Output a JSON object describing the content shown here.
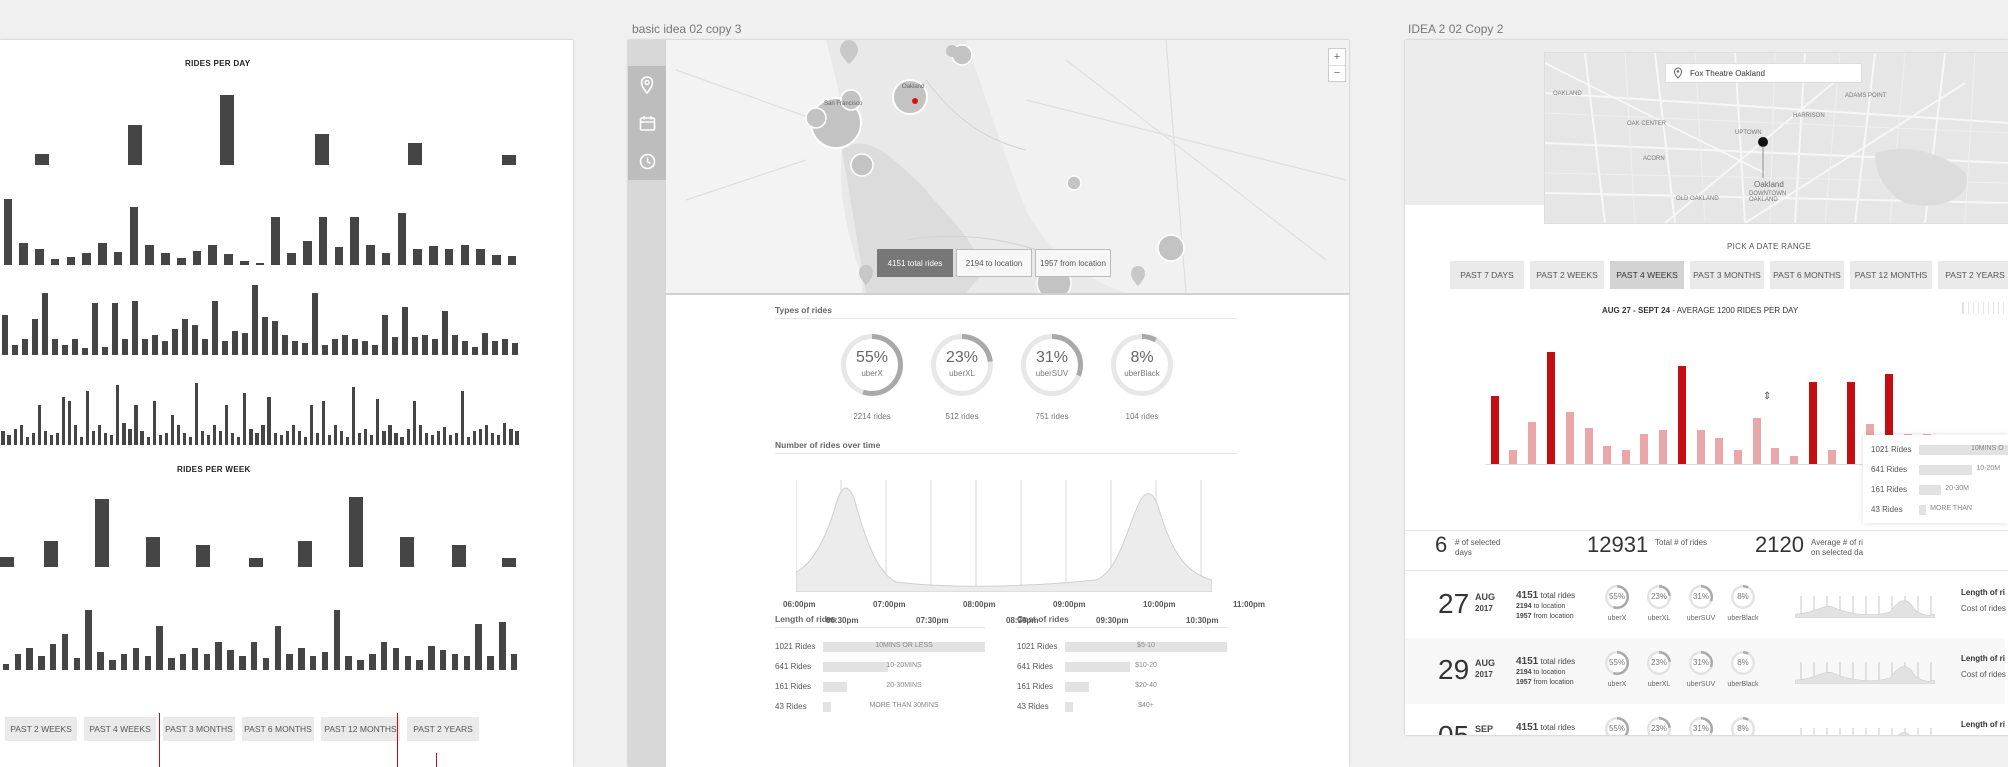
{
  "frames": {
    "middle_title": "basic idea 02 copy 3",
    "right_title": "IDEA 2 02 Copy 2"
  },
  "left": {
    "rides_per_day_title": "RIDES PER DAY",
    "rides_per_week_title": "RIDES PER WEEK",
    "range_buttons": [
      "PAST 2 WEEKS",
      "PAST 4 WEEKS",
      "PAST 3 MONTHS",
      "PAST 6 MONTHS",
      "PAST 12 MONTHS",
      "PAST 2 YEARS"
    ],
    "day_rows": [
      [
        11,
        40,
        70,
        31,
        22,
        10
      ],
      [
        66,
        22,
        16,
        6,
        8,
        12,
        22,
        13,
        58,
        20,
        12,
        7,
        14,
        20,
        11,
        4,
        2,
        48,
        12,
        24,
        48,
        18,
        48,
        20,
        12,
        52,
        16,
        19,
        16,
        20,
        16,
        10,
        9
      ],
      [
        40,
        10,
        16,
        36,
        62,
        16,
        10,
        16,
        7,
        52,
        8,
        52,
        16,
        54,
        16,
        20,
        14,
        26,
        36,
        30,
        16,
        54,
        14,
        24,
        22,
        70,
        38,
        34,
        20,
        14,
        12,
        62,
        10,
        16,
        20,
        16,
        14,
        10,
        40,
        18,
        48,
        18,
        20,
        16,
        44,
        20,
        14,
        8,
        22,
        14,
        16,
        12
      ],
      [
        14,
        10,
        16,
        20,
        8,
        12,
        40,
        14,
        10,
        12,
        48,
        44,
        20,
        8,
        54,
        14,
        20,
        12,
        10,
        60,
        22,
        16,
        40,
        14,
        8,
        44,
        10,
        12,
        30,
        20,
        12,
        8,
        62,
        14,
        10,
        20,
        14,
        40,
        12,
        8,
        52,
        16,
        12,
        20,
        48,
        12,
        10,
        14,
        20,
        14,
        8,
        40,
        12,
        44,
        10,
        20,
        14,
        8,
        58,
        12,
        16,
        10,
        46,
        14,
        20,
        12,
        8,
        16,
        44,
        20,
        12,
        10,
        14,
        18,
        10,
        12,
        54,
        8,
        14,
        16,
        20,
        12,
        10,
        22,
        16,
        14
      ]
    ],
    "week_rows": [
      [
        10,
        26,
        68,
        30,
        22,
        9,
        26,
        70,
        30,
        22,
        9
      ],
      [
        6,
        16,
        22,
        14,
        26,
        36,
        12,
        60,
        18,
        10,
        16,
        22,
        14,
        44,
        12,
        16,
        22,
        16,
        28,
        20,
        14,
        28,
        12,
        44,
        16,
        22,
        14,
        18,
        60,
        14,
        10,
        16,
        28,
        22,
        14,
        10,
        24,
        20,
        16,
        14,
        46,
        14,
        48,
        16
      ]
    ]
  },
  "middle": {
    "map_buttons": [
      "4151 total rides",
      "2194 to location",
      "1957 from location"
    ],
    "map_controls": [
      "+",
      "−"
    ],
    "map_labels": [
      "San Francisco",
      "Oakland"
    ],
    "types_title": "Types of rides",
    "types": [
      {
        "pct": "55%",
        "name": "uberX",
        "rides": "2214 rides",
        "value": 55
      },
      {
        "pct": "23%",
        "name": "uberXL",
        "rides": "512 rides",
        "value": 23
      },
      {
        "pct": "31%",
        "name": "uberSUV",
        "rides": "751 rides",
        "value": 31
      },
      {
        "pct": "8%",
        "name": "uberBlack",
        "rides": "104 rides",
        "value": 8
      }
    ],
    "over_time_title": "Number of rides over time",
    "time_labels_top": [
      "06:00pm",
      "07:00pm",
      "08:00pm",
      "09:00pm",
      "10:00pm",
      "11:00pm"
    ],
    "time_labels_bottom": [
      "06:30pm",
      "07:30pm",
      "08:30pm",
      "09:30pm",
      "10:30pm"
    ],
    "length_title": "Length of rides",
    "length": [
      {
        "rides": "1021 Rides",
        "label": "10MINS OR LESS",
        "value": 100
      },
      {
        "rides": "641 Rides",
        "label": "10-20MINS",
        "value": 40
      },
      {
        "rides": "161 Rides",
        "label": "20-30MINS",
        "value": 15
      },
      {
        "rides": "43 Rides",
        "label": "MORE THAN 30MINS",
        "value": 5
      }
    ],
    "cost_title": "Cost of rides",
    "cost": [
      {
        "rides": "1021 Rides",
        "label": "$5-10",
        "value": 100
      },
      {
        "rides": "641 Rides",
        "label": "$10-20",
        "value": 40
      },
      {
        "rides": "161 Rides",
        "label": "$20-40",
        "value": 15
      },
      {
        "rides": "43 Rides",
        "label": "$40+",
        "value": 5
      }
    ]
  },
  "right": {
    "location": "Fox Theatre Oakland",
    "map_labels": [
      "OAKLAND",
      "OAK CENTER",
      "UPTOWN",
      "ACORN",
      "ADAMS POINT",
      "HARRISON",
      "Oakland",
      "DOWNTOWN OAKLAND",
      "OLD OAKLAND"
    ],
    "date_range_title": "PICK A DATE RANGE",
    "date_buttons": [
      "PAST 7 DAYS",
      "PAST 2 WEEKS",
      "PAST 4 WEEKS",
      "PAST 3 MONTHS",
      "PAST 6 MONTHS",
      "PAST 12 MONTHS",
      "PAST 2 YEARS"
    ],
    "selected_button": 2,
    "summary_bold": "AUG 27 - SEPT 24",
    "summary_rest": " - AVERAGE 1200 RIDES PER DAY",
    "red_bars": [
      {
        "v": 68,
        "c": "#c40e12"
      },
      {
        "v": 14,
        "c": "#e9a7a9"
      },
      {
        "v": 42,
        "c": "#e9a7a9"
      },
      {
        "v": 112,
        "c": "#c40e12"
      },
      {
        "v": 52,
        "c": "#e9a7a9"
      },
      {
        "v": 36,
        "c": "#e9a7a9"
      },
      {
        "v": 18,
        "c": "#e9a7a9"
      },
      {
        "v": 14,
        "c": "#e9a7a9"
      },
      {
        "v": 30,
        "c": "#e9a7a9"
      },
      {
        "v": 34,
        "c": "#e9a7a9"
      },
      {
        "v": 98,
        "c": "#c40e12"
      },
      {
        "v": 34,
        "c": "#e9a7a9"
      },
      {
        "v": 26,
        "c": "#e9a7a9"
      },
      {
        "v": 14,
        "c": "#e9a7a9"
      },
      {
        "v": 46,
        "c": "#e9a7a9"
      },
      {
        "v": 16,
        "c": "#e9a7a9"
      },
      {
        "v": 8,
        "c": "#e9a7a9"
      },
      {
        "v": 82,
        "c": "#c40e12"
      },
      {
        "v": 14,
        "c": "#e9a7a9"
      },
      {
        "v": 82,
        "c": "#c40e12"
      },
      {
        "v": 40,
        "c": "#e9a7a9"
      },
      {
        "v": 90,
        "c": "#c40e12"
      },
      {
        "v": 30,
        "c": "#e9a7a9"
      },
      {
        "v": 30,
        "c": "#e9a7a9"
      }
    ],
    "tooltip": [
      {
        "rides": "1021 Rides",
        "label": "10MINS O",
        "value": 100
      },
      {
        "rides": "641 Rides",
        "label": "10-20M",
        "value": 60
      },
      {
        "rides": "161 Rides",
        "label": "20-30M",
        "value": 25
      },
      {
        "rides": "43 Rides",
        "label": "MORE THAN",
        "value": 8
      }
    ],
    "stats": [
      {
        "num": "6",
        "label": "# of selected days"
      },
      {
        "num": "12931",
        "label": "Total # of rides"
      },
      {
        "num": "2120",
        "label": "Average # of ri on selected da"
      }
    ],
    "days": [
      {
        "day": "27",
        "month": "AUG",
        "year": "2017",
        "total": "4151",
        "total_label": "total rides",
        "to": "2194",
        "to_label": "to location",
        "from": "1957",
        "from_label": "from location"
      },
      {
        "day": "29",
        "month": "AUG",
        "year": "2017",
        "total": "4151",
        "total_label": "total rides",
        "to": "2194",
        "to_label": "to location",
        "from": "1957",
        "from_label": "from location"
      },
      {
        "day": "05",
        "month": "SEP",
        "year": "2017",
        "total": "4151",
        "total_label": "total rides",
        "to": "2194",
        "to_label": "to location",
        "from": "1957",
        "from_label": "from location"
      }
    ],
    "day_types": [
      {
        "pct": "55%",
        "name": "uberX",
        "value": 55
      },
      {
        "pct": "23%",
        "name": "uberXL",
        "value": 23
      },
      {
        "pct": "31%",
        "name": "uberSUV",
        "value": 31
      },
      {
        "pct": "8%",
        "name": "uberBlack",
        "value": 8
      }
    ],
    "day_side": [
      "Length of ri",
      "Cost of rides"
    ]
  },
  "colors": {
    "red": "#c40e12",
    "pink": "#e9a7a9",
    "dark_bar": "#454545"
  }
}
